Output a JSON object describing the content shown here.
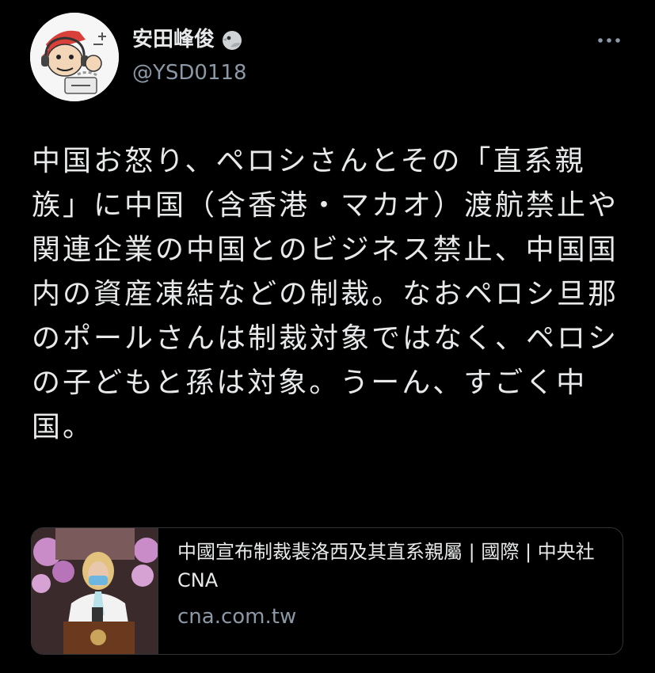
{
  "author": {
    "display_name": "安田峰俊",
    "handle": "@YSD0118",
    "name_emoji": "bird-emoji"
  },
  "menu": {
    "more_icon": "more-dots-icon"
  },
  "tweet": {
    "text": "中国お怒り、ペロシさんとその「直系親族」に中国（含香港・マカオ）渡航禁止や関連企業の中国とのビジネス禁止、中国国内の資産凍結などの制裁。なおペロシ旦那のポールさんは制裁対象ではなく、ペロシの子どもと孫は対象。うーん、すごく中国。"
  },
  "card": {
    "title": "中國宣布制裁裴洛西及其直系親屬 | 國際 | 中央社 CNA",
    "domain": "cna.com.tw"
  },
  "colors": {
    "background": "#000000",
    "text": "#e7e9ea",
    "secondary": "#8b98a5",
    "border": "#2f3336"
  }
}
